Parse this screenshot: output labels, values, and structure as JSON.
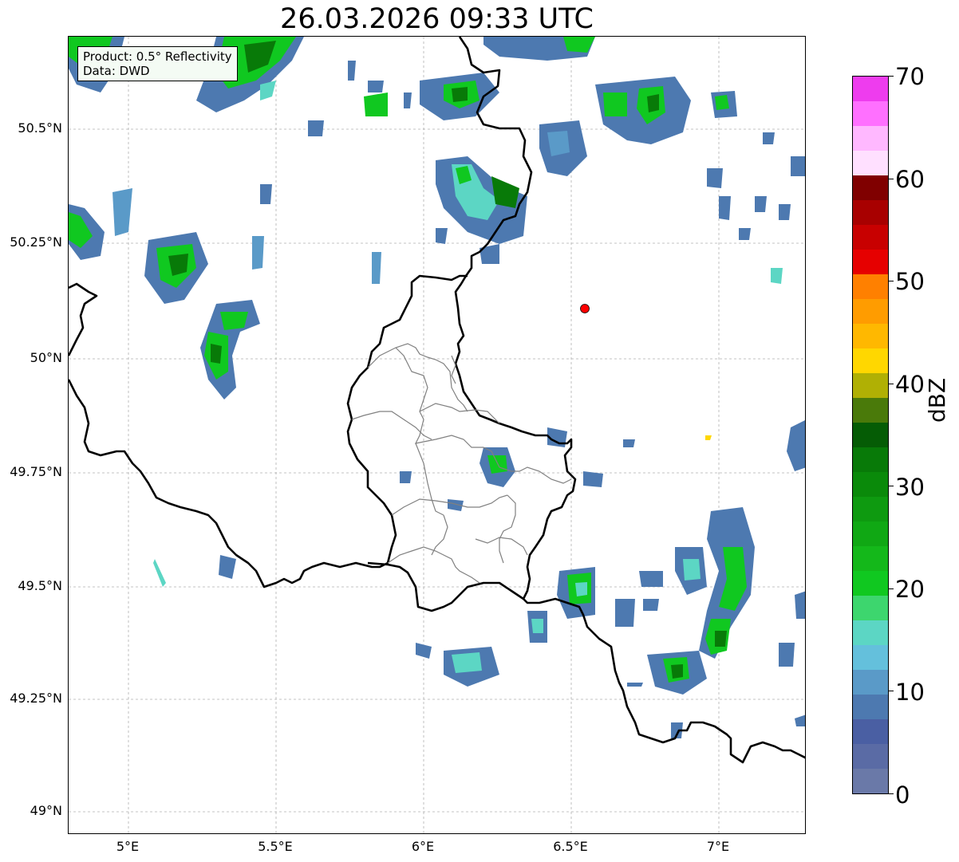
{
  "title": "26.03.2026 09:33 UTC",
  "info": {
    "product": "Product: 0.5° Reflectivity",
    "data": "Data: DWD"
  },
  "lat_labels": [
    "50.5°N",
    "50.25°N",
    "50°N",
    "49.75°N",
    "49.5°N",
    "49.25°N",
    "49°N"
  ],
  "lon_labels": [
    "5°E",
    "5.5°E",
    "6°E",
    "6.5°E",
    "7°E"
  ],
  "colorbar": {
    "unit": "dBZ",
    "min": 0,
    "max": 70,
    "tick_labels": [
      "0",
      "10",
      "20",
      "30",
      "40",
      "50",
      "60",
      "70"
    ],
    "colors": [
      "#6a79a8",
      "#5a6ba5",
      "#4a5fa3",
      "#4d79b0",
      "#5a9ac8",
      "#64c0dc",
      "#5cd6c4",
      "#3dd66e",
      "#10c820",
      "#14b81a",
      "#10a814",
      "#0e9a10",
      "#0a8a0a",
      "#087a08",
      "#055c05",
      "#4a7a0a",
      "#b0b004",
      "#ffd700",
      "#ffb800",
      "#ff9c00",
      "#ff8000",
      "#e60000",
      "#c80000",
      "#a80000",
      "#800000",
      "#ffe0ff",
      "#ffb8ff",
      "#ff70ff",
      "#ee3cee"
    ]
  },
  "map_extent": {
    "lon": [
      4.8,
      7.3
    ],
    "lat": [
      48.95,
      50.7
    ]
  },
  "radar_site": {
    "lon": 6.548,
    "lat": 50.11,
    "color": "#ff0000"
  },
  "echo_colors": {
    "weak": "#4d79b0",
    "light": "#5a9ac8",
    "cyan": "#5cd6c4",
    "green": "#10c820",
    "dark_green": "#087a08"
  }
}
